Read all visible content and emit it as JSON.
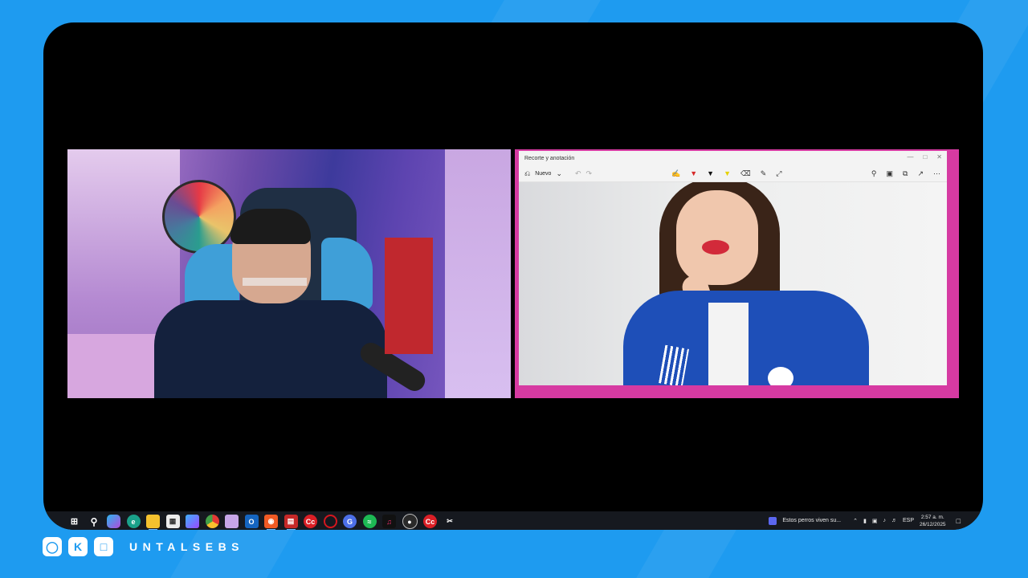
{
  "snip_window": {
    "title": "Recorte y anotación",
    "new_label": "Nuevo",
    "minimize_icon": "minimize-icon",
    "maximize_icon": "maximize-icon",
    "close_icon": "close-icon"
  },
  "taskbar": {
    "notification_text": "Estos perros viven su...",
    "language": "ESP",
    "time": "2:57 a. m.",
    "date": "26/12/2025"
  },
  "footer": {
    "brand": "UNTALSEBS"
  },
  "colors": {
    "background": "#1e9bf0",
    "capture_border": "#d63aa2",
    "taskbar": "#16191f"
  }
}
